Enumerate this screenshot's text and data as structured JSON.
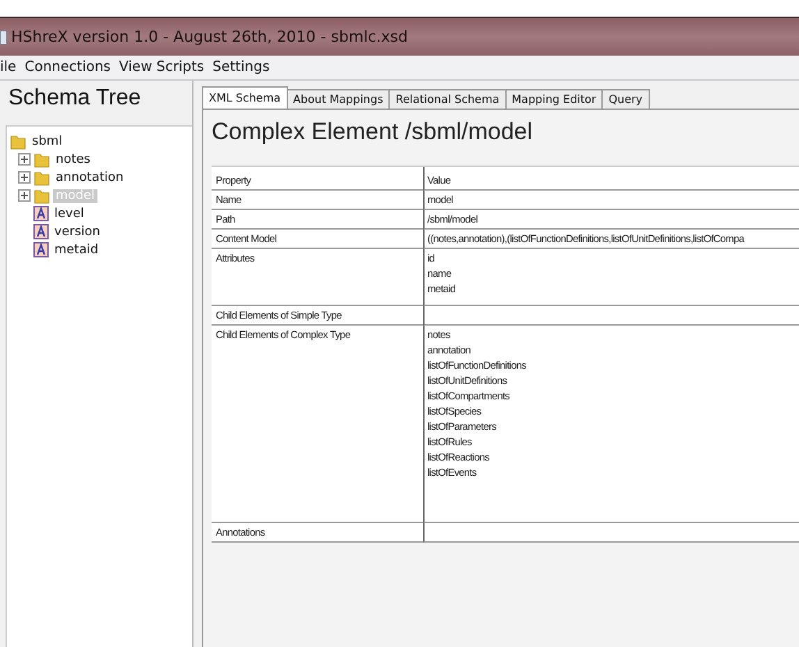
{
  "window": {
    "title": "HShreX version 1.0 - August 26th, 2010 - sbmlc.xsd"
  },
  "menu": [
    "ile",
    "Connections",
    "View Scripts",
    "Settings"
  ],
  "sidebar": {
    "title": "Schema Tree",
    "tree": {
      "label": "sbml",
      "kind": "folder",
      "selected": false,
      "children": [
        {
          "label": "notes",
          "kind": "folder",
          "expanded": false,
          "selected": false
        },
        {
          "label": "annotation",
          "kind": "folder",
          "expanded": false,
          "selected": false
        },
        {
          "label": "model",
          "kind": "folder",
          "expanded": false,
          "selected": true
        },
        {
          "label": "level",
          "kind": "attribute",
          "selected": false
        },
        {
          "label": "version",
          "kind": "attribute",
          "selected": false
        },
        {
          "label": "metaid",
          "kind": "attribute",
          "selected": false
        }
      ]
    }
  },
  "tabs": [
    {
      "label": "XML Schema",
      "selected": true
    },
    {
      "label": "About Mappings",
      "selected": false
    },
    {
      "label": "Relational Schema",
      "selected": false
    },
    {
      "label": "Mapping Editor",
      "selected": false
    },
    {
      "label": "Query",
      "selected": false
    }
  ],
  "heading": "Complex Element /sbml/model",
  "table": {
    "columns": [
      "Property",
      "Value"
    ],
    "rows": [
      {
        "property": "Name",
        "values": [
          "model"
        ]
      },
      {
        "property": "Path",
        "values": [
          "/sbml/model"
        ]
      },
      {
        "property": "Content Model",
        "values": [
          "((notes,annotation),(listOfFunctionDefinitions,listOfUnitDefinitions,listOfCompa"
        ]
      },
      {
        "property": "Attributes",
        "values": [
          "id",
          "name",
          "metaid"
        ]
      },
      {
        "property": "Child Elements of Simple Type",
        "values": []
      },
      {
        "property": "Child Elements of Complex Type",
        "values": [
          "notes",
          "annotation",
          "listOfFunctionDefinitions",
          "listOfUnitDefinitions",
          "listOfCompartments",
          "listOfSpecies",
          "listOfParameters",
          "listOfRules",
          "listOfReactions",
          "listOfEvents"
        ]
      },
      {
        "property": "Annotations",
        "values": []
      }
    ]
  }
}
